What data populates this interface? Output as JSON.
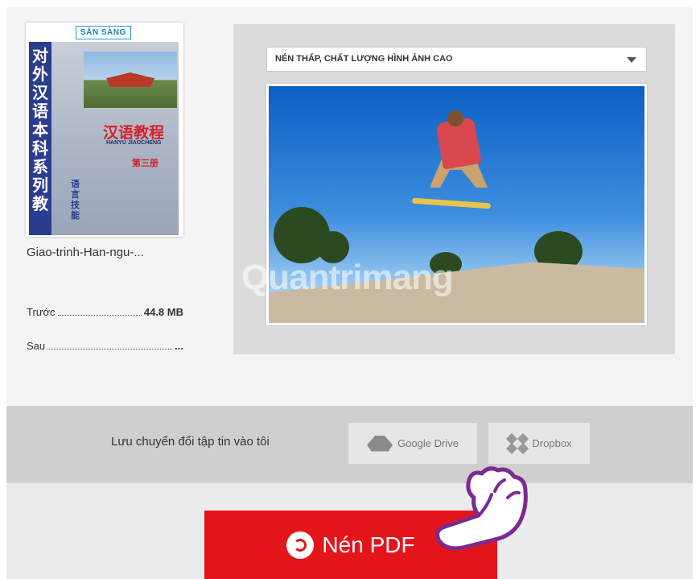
{
  "file": {
    "badge": "SẴN SÀNG",
    "name": "Giao-trinh-Han-ngu-...",
    "cover": {
      "vertical_title": [
        "对",
        "外",
        "汉",
        "语",
        "本",
        "科",
        "系",
        "列",
        "教"
      ],
      "title": "汉语教程",
      "subtitle": "HANYU JIAOCHENG",
      "volume": "第三册",
      "side_text": [
        "语",
        "言",
        "技",
        "能"
      ]
    }
  },
  "stats": {
    "before_label": "Trước",
    "before_value": "44.8 MB",
    "after_label": "Sau",
    "after_value": "..."
  },
  "compression": {
    "selected_option": "NÉN THẤP, CHẤT LƯỢNG HÌNH ẢNH CAO"
  },
  "preview": {
    "watermark": "Quantrimang"
  },
  "save": {
    "label": "Lưu chuyển đổi tập tin vào tôi",
    "google_drive": "Google Drive",
    "dropbox": "Dropbox"
  },
  "action": {
    "compress_label": "Nén PDF"
  },
  "colors": {
    "accent": "#e4141b",
    "badge": "#1a9fc9"
  }
}
